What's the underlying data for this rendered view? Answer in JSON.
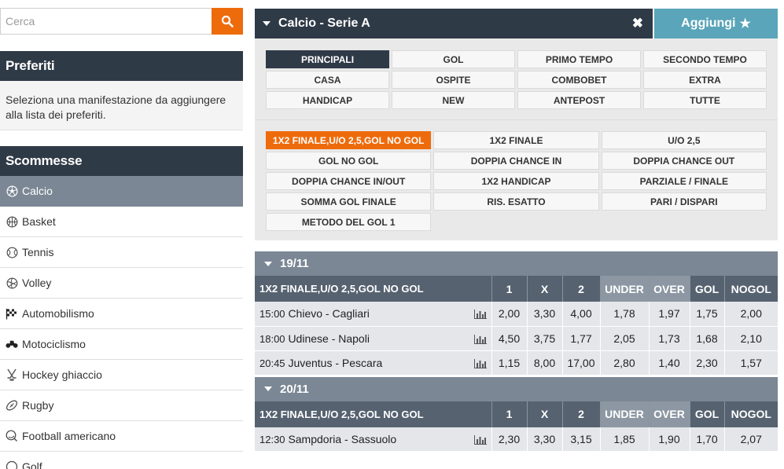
{
  "search": {
    "placeholder": "Cerca",
    "icon": "search-icon"
  },
  "favorites": {
    "title": "Preferiti",
    "text": "Seleziona una manifestazione da aggiungere alla lista dei preferiti."
  },
  "bets": {
    "title": "Scommesse",
    "sports": [
      {
        "label": "Calcio",
        "icon": "soccer-ball-icon",
        "active": true
      },
      {
        "label": "Basket",
        "icon": "basketball-icon"
      },
      {
        "label": "Tennis",
        "icon": "tennis-ball-icon"
      },
      {
        "label": "Volley",
        "icon": "volleyball-icon"
      },
      {
        "label": "Automobilismo",
        "icon": "checkered-flag-icon"
      },
      {
        "label": "Motociclismo",
        "icon": "motorcycle-icon"
      },
      {
        "label": "Hockey ghiaccio",
        "icon": "hockey-sticks-icon"
      },
      {
        "label": "Rugby",
        "icon": "rugby-ball-icon"
      },
      {
        "label": "Football americano",
        "icon": "american-football-icon"
      },
      {
        "label": "Golf",
        "icon": "golf-icon"
      }
    ]
  },
  "header": {
    "title": "Calcio - Serie A",
    "close_label": "✖",
    "add_label": "Aggiungi"
  },
  "categories": [
    "PRINCIPALI",
    "GOL",
    "PRIMO TEMPO",
    "SECONDO TEMPO",
    "CASA",
    "OSPITE",
    "COMBOBET",
    "EXTRA",
    "HANDICAP",
    "NEW",
    "ANTEPOST",
    "TUTTE"
  ],
  "markets": [
    "1X2 FINALE,U/O 2,5,GOL NO GOL",
    "1X2 FINALE",
    "U/O 2,5",
    "GOL NO GOL",
    "DOPPIA CHANCE IN",
    "DOPPIA CHANCE OUT",
    "DOPPIA CHANCE IN/OUT",
    "1X2 HANDICAP",
    "PARZIALE / FINALE",
    "SOMMA GOL FINALE",
    "RIS. ESATTO",
    "PARI / DISPARI",
    "METODO DEL GOL 1"
  ],
  "colors": {
    "dark": "#2f3a47",
    "accent": "#ee6b0c",
    "teal": "#5aa5b9",
    "gray": "#7b8794"
  },
  "days": [
    {
      "date": "19/11",
      "market_label": "1X2 FINALE,U/O 2,5,GOL NO GOL",
      "columns": [
        "1",
        "X",
        "2",
        "UNDER",
        "OVER",
        "GOL",
        "NOGOL"
      ],
      "events": [
        {
          "time": "15:00",
          "name": "Chievo - Cagliari",
          "odds": [
            "2,00",
            "3,30",
            "4,00",
            "1,78",
            "1,97",
            "1,75",
            "2,00"
          ]
        },
        {
          "time": "18:00",
          "name": "Udinese - Napoli",
          "odds": [
            "4,50",
            "3,75",
            "1,77",
            "2,05",
            "1,73",
            "1,68",
            "2,10"
          ]
        },
        {
          "time": "20:45",
          "name": "Juventus - Pescara",
          "odds": [
            "1,15",
            "8,00",
            "17,00",
            "2,80",
            "1,40",
            "2,30",
            "1,57"
          ]
        }
      ]
    },
    {
      "date": "20/11",
      "market_label": "1X2 FINALE,U/O 2,5,GOL NO GOL",
      "columns": [
        "1",
        "X",
        "2",
        "UNDER",
        "OVER",
        "GOL",
        "NOGOL"
      ],
      "events": [
        {
          "time": "12:30",
          "name": "Sampdoria - Sassuolo",
          "odds": [
            "2,30",
            "3,30",
            "3,15",
            "1,85",
            "1,90",
            "1,70",
            "2,07"
          ]
        }
      ]
    }
  ]
}
